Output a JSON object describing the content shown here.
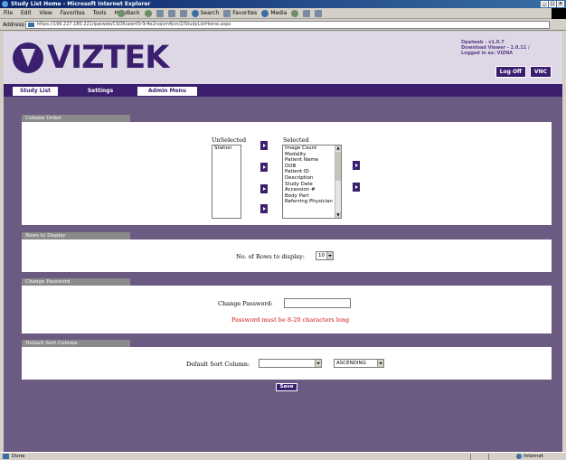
{
  "window": {
    "title": "Study List Home - Microsoft Internet Explorer",
    "controls": [
      "_",
      "□",
      "×"
    ]
  },
  "browser": {
    "menus": [
      "File",
      "Edit",
      "View",
      "Favorites",
      "Tools",
      "Help"
    ],
    "toolbar": {
      "back": "Back",
      "search": "Search",
      "favorites": "Favorites",
      "media": "Media"
    },
    "address_label": "Address",
    "address_value": "https://199.227.180.221/ipalweb/CSOR/alert5r3r4e2nojsm4jvn/2/StudyListHome.aspx"
  },
  "header": {
    "brand": "VIZTEK",
    "version_lines": [
      "Opalweb - v1.0.7",
      "Download Viewer - 1.0.11 /",
      "Logged in as: VIZNA"
    ],
    "logoff_label": "Log Off",
    "vnc_label": "VNC"
  },
  "nav": {
    "tabs": [
      {
        "label": "Study List",
        "active": false
      },
      {
        "label": "Settings",
        "active": true
      },
      {
        "label": "Admin Menu",
        "active": false
      }
    ]
  },
  "column_order": {
    "title": "Column Order",
    "unselected_label": "UnSelected",
    "selected_label": "Selected",
    "unselected_items": [
      "Station"
    ],
    "selected_items": [
      "Image Count",
      "Modality",
      "Patient Name",
      "DOB",
      "Patient ID",
      "Description",
      "Study Date",
      "Accession #",
      "Body Part",
      "Referring Physician"
    ]
  },
  "rows_to_display": {
    "title": "Rows to Display",
    "label": "No. of Rows to display:",
    "value": "10"
  },
  "change_password": {
    "title": "Change Password",
    "label": "Change Password:",
    "value": "",
    "hint": "Password must be 8-20 characters long"
  },
  "default_sort": {
    "title": "Default Sort Column",
    "label": "Default Sort Column:",
    "column_value": "",
    "order_value": "ASCENDING"
  },
  "save_label": "Save",
  "status": {
    "left": "Done",
    "zone": "Internet"
  },
  "colors": {
    "brand_purple": "#3b1f6e",
    "page_background": "#6b5b82",
    "header_background": "#ded8e6",
    "section_title_gray": "#8a8a8a",
    "hint_red": "#d01010"
  }
}
